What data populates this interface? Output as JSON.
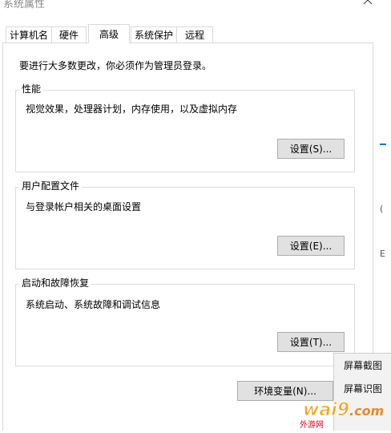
{
  "window": {
    "title": "系统属性"
  },
  "tabs": [
    {
      "label": "计算机名"
    },
    {
      "label": "硬件"
    },
    {
      "label": "高级"
    },
    {
      "label": "系统保护"
    },
    {
      "label": "远程"
    }
  ],
  "notice": "要进行大多数更改，你必须作为管理员登录。",
  "performance": {
    "legend": "性能",
    "description": "视觉效果，处理器计划，内存使用，以及虚拟内存",
    "settings_label": "设置(S)..."
  },
  "user_profiles": {
    "legend": "用户配置文件",
    "description": "与登录帐户相关的桌面设置",
    "settings_label": "设置(E)..."
  },
  "startup_recovery": {
    "legend": "启动和故障恢复",
    "description": "系统启动、系统故障和调试信息",
    "settings_label": "设置(T)..."
  },
  "env_vars_label": "环境变量(N)...",
  "context_menu": {
    "items": [
      {
        "label": "屏幕截图"
      },
      {
        "label": "屏幕识图"
      }
    ]
  },
  "watermark": {
    "text": "wai9",
    "sub_text": "外游网"
  },
  "colors": {
    "accent_edge": "#0078d7",
    "watermark_orange": "#f5a623"
  }
}
